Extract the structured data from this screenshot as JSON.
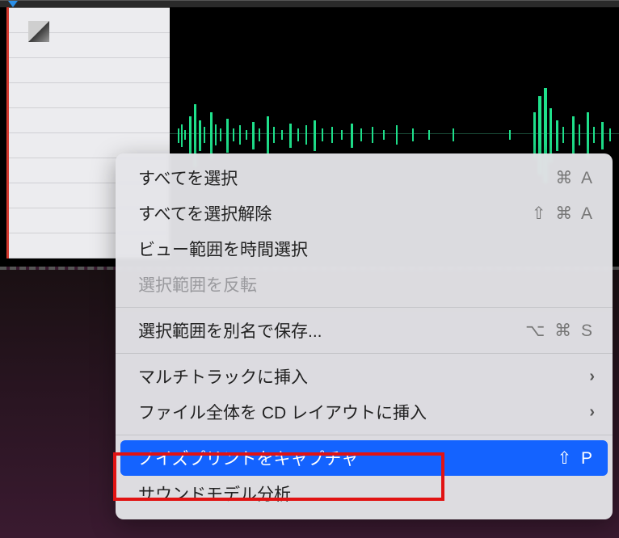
{
  "menu": {
    "items": [
      {
        "label": "すべてを選択",
        "shortcut": "⌘ A",
        "enabled": true
      },
      {
        "label": "すべてを選択解除",
        "shortcut": "⇧ ⌘ A",
        "enabled": true
      },
      {
        "label": "ビュー範囲を時間選択",
        "shortcut": "",
        "enabled": true
      },
      {
        "label": "選択範囲を反転",
        "shortcut": "",
        "enabled": false
      }
    ],
    "save_as": {
      "label": "選択範囲を別名で保存...",
      "shortcut": "⌥ ⌘ S"
    },
    "submenu1": {
      "label": "マルチトラックに挿入"
    },
    "submenu2": {
      "label": "ファイル全体を CD レイアウトに挿入"
    },
    "capture": {
      "label": "ノイズプリントをキャプチャ",
      "shortcut": "⇧ P"
    },
    "sound_model": {
      "label": "サウンドモデル分析"
    }
  }
}
